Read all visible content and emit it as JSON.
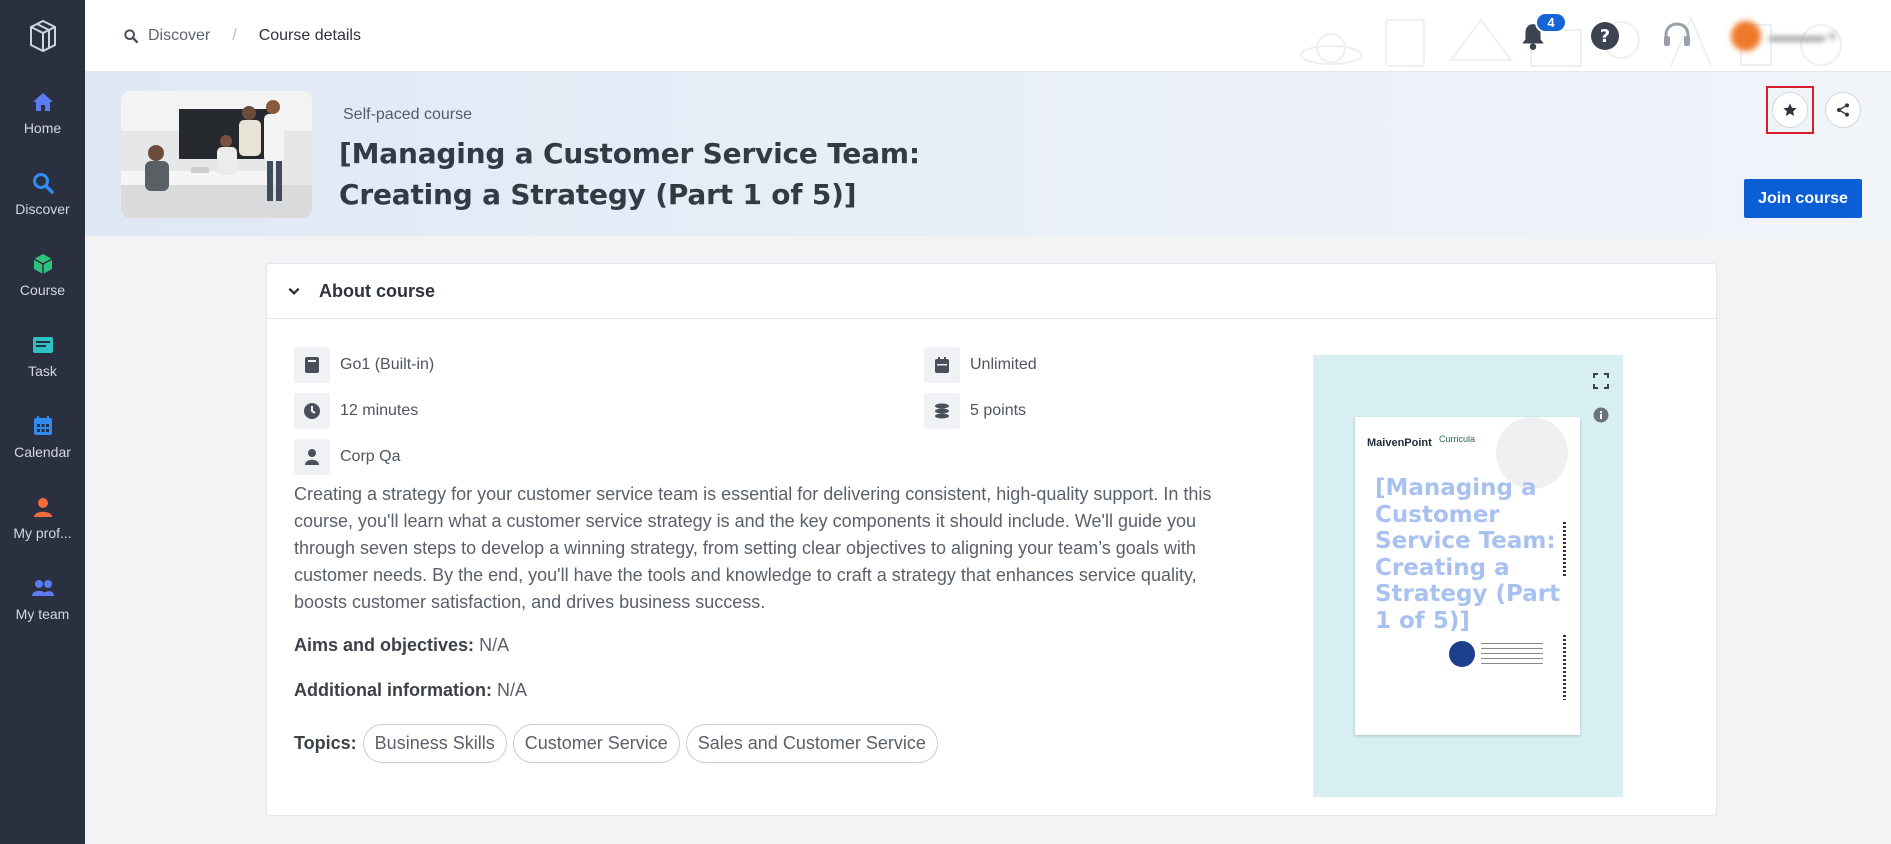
{
  "sidebar": {
    "items": [
      {
        "label": "Home",
        "icon": "home-icon",
        "color": "#5b7cf0"
      },
      {
        "label": "Discover",
        "icon": "search-icon",
        "color": "#2f8df0"
      },
      {
        "label": "Course",
        "icon": "cube-icon",
        "color": "#2ec27e"
      },
      {
        "label": "Task",
        "icon": "task-icon",
        "color": "#2ec2c2"
      },
      {
        "label": "Calendar",
        "icon": "calendar-icon",
        "color": "#2f8df0"
      },
      {
        "label": "My prof...",
        "icon": "user-icon",
        "color": "#f26b3a"
      },
      {
        "label": "My team",
        "icon": "team-icon",
        "color": "#5b7cf0"
      }
    ]
  },
  "breadcrumb": {
    "discover": "Discover",
    "current": "Course details"
  },
  "topbar": {
    "notification_count": "4"
  },
  "hero": {
    "type": "Self-paced course",
    "title": "[Managing a Customer Service Team: Creating a Strategy (Part 1 of 5)]",
    "join_label": "Join course"
  },
  "about": {
    "heading": "About course",
    "provider": "Go1 (Built-in)",
    "duration": "12 minutes",
    "author": "Corp Qa",
    "availability": "Unlimited",
    "points": "5 points",
    "description": "Creating a strategy for your customer service team is essential for delivering consistent, high-quality support. In this course, you'll learn what a customer service strategy is and the key components it should include. We'll guide you through seven steps to develop a winning strategy, from setting clear objectives to aligning your team’s goals with customer needs. By the end, you'll have the tools and knowledge to craft a strategy that enhances service quality, boosts customer satisfaction, and drives business success.",
    "aims_label": "Aims and objectives:",
    "aims_value": "N/A",
    "additional_label": "Additional information:",
    "additional_value": "N/A",
    "topics_label": "Topics:",
    "topics": [
      "Business Skills",
      "Customer Service",
      "Sales and Customer Service"
    ]
  },
  "preview": {
    "brand": "MaivenPoint",
    "brand2": "Curricula",
    "title": "[Managing a Customer Service Team: Creating a Strategy (Part 1 of 5)]"
  }
}
